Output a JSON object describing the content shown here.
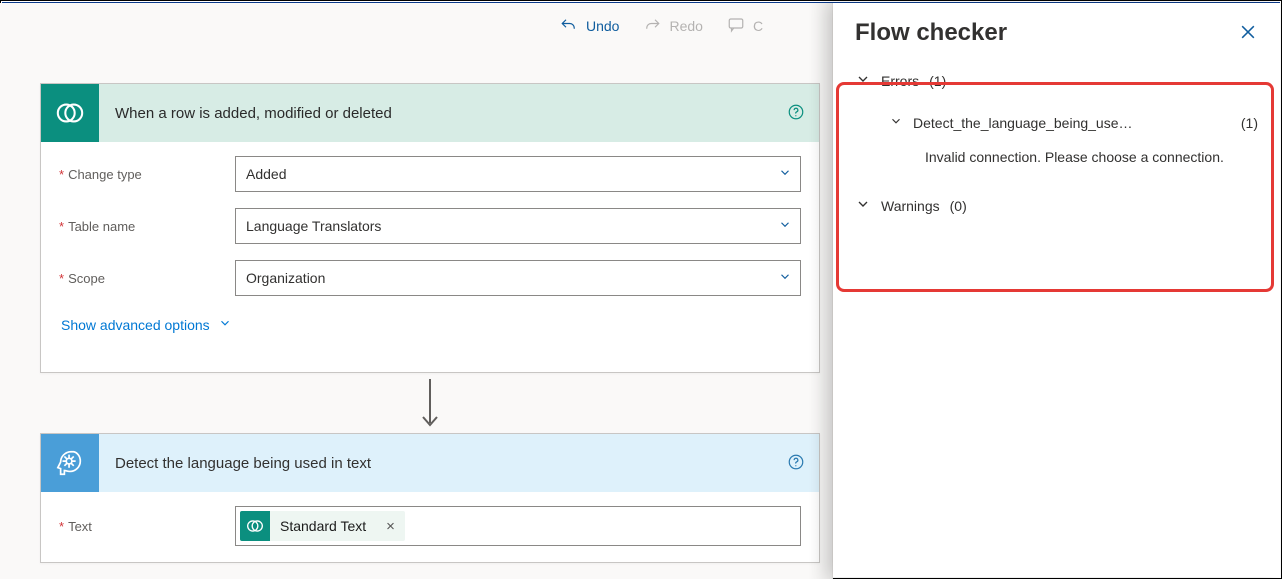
{
  "toolbar": {
    "undo": "Undo",
    "redo": "Redo",
    "comments": "Co"
  },
  "trigger": {
    "title": "When a row is added, modified or deleted",
    "fields": {
      "change_type_label": "Change type",
      "change_type_value": "Added",
      "table_name_label": "Table name",
      "table_name_value": "Language Translators",
      "scope_label": "Scope",
      "scope_value": "Organization"
    },
    "advanced": "Show advanced options"
  },
  "action": {
    "title": "Detect the language being used in text",
    "fields": {
      "text_label": "Text",
      "token": "Standard Text"
    }
  },
  "panel": {
    "title": "Flow checker",
    "errors": {
      "label": "Errors",
      "count": "(1)",
      "items": [
        {
          "name": "Detect_the_language_being_use…",
          "count": "(1)",
          "message": "Invalid connection. Please choose a connection."
        }
      ]
    },
    "warnings": {
      "label": "Warnings",
      "count": "(0)"
    }
  }
}
